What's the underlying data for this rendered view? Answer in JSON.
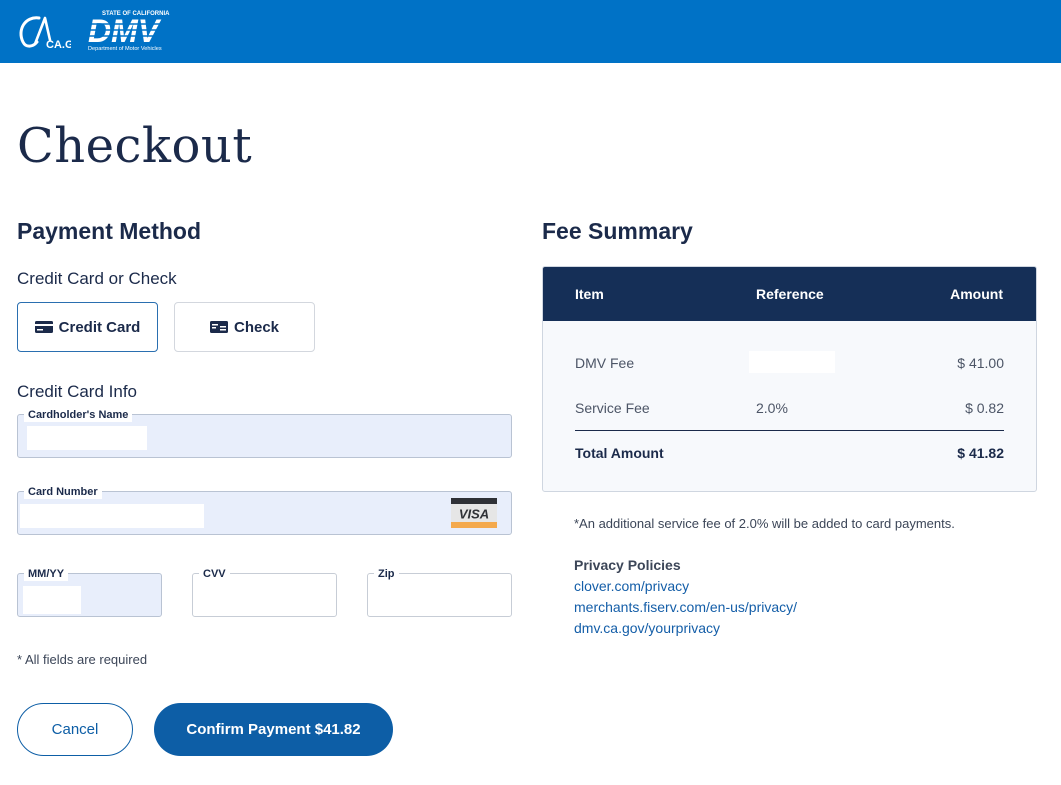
{
  "header": {
    "ca_logo_text": "CA.GOV",
    "dmv_logo_text": "DMV",
    "dmv_logo_top": "STATE OF CALIFORNIA",
    "dmv_logo_bottom": "Department of Motor Vehicles",
    "brand_color": "#0072c6"
  },
  "page_title": "Checkout",
  "payment": {
    "title": "Payment Method",
    "method_label": "Credit Card or Check",
    "methods": [
      {
        "label": "Credit Card",
        "icon": "credit-card-icon",
        "selected": true
      },
      {
        "label": "Check",
        "icon": "check-icon",
        "selected": false
      }
    ],
    "info_label": "Credit Card Info",
    "fields": {
      "cardholder": {
        "label": "Cardholder's Name",
        "value": ""
      },
      "card_number": {
        "label": "Card Number",
        "value": "",
        "brand": "VISA"
      },
      "mmyy": {
        "label": "MM/YY",
        "value": ""
      },
      "cvv": {
        "label": "CVV",
        "value": ""
      },
      "zip": {
        "label": "Zip",
        "value": ""
      }
    },
    "required_note": "* All fields are required",
    "cancel_label": "Cancel",
    "confirm_label": "Confirm Payment $41.82"
  },
  "fees": {
    "title": "Fee Summary",
    "headers": {
      "item": "Item",
      "reference": "Reference",
      "amount": "Amount"
    },
    "rows": [
      {
        "item": "DMV Fee",
        "reference": "",
        "amount": "$ 41.00"
      },
      {
        "item": "Service Fee",
        "reference": "2.0%",
        "amount": "$ 0.82"
      }
    ],
    "total": {
      "label": "Total Amount",
      "amount": "$ 41.82"
    },
    "note": "*An additional service fee of 2.0% will be added to card payments.",
    "privacy_title": "Privacy Policies",
    "privacy_links": [
      "clover.com/privacy",
      "merchants.fiserv.com/en-us/privacy/",
      "dmv.ca.gov/yourprivacy"
    ]
  },
  "colors": {
    "navy": "#152f57",
    "primary_button": "#0d5ea6",
    "field_fill": "#e8eefb"
  }
}
